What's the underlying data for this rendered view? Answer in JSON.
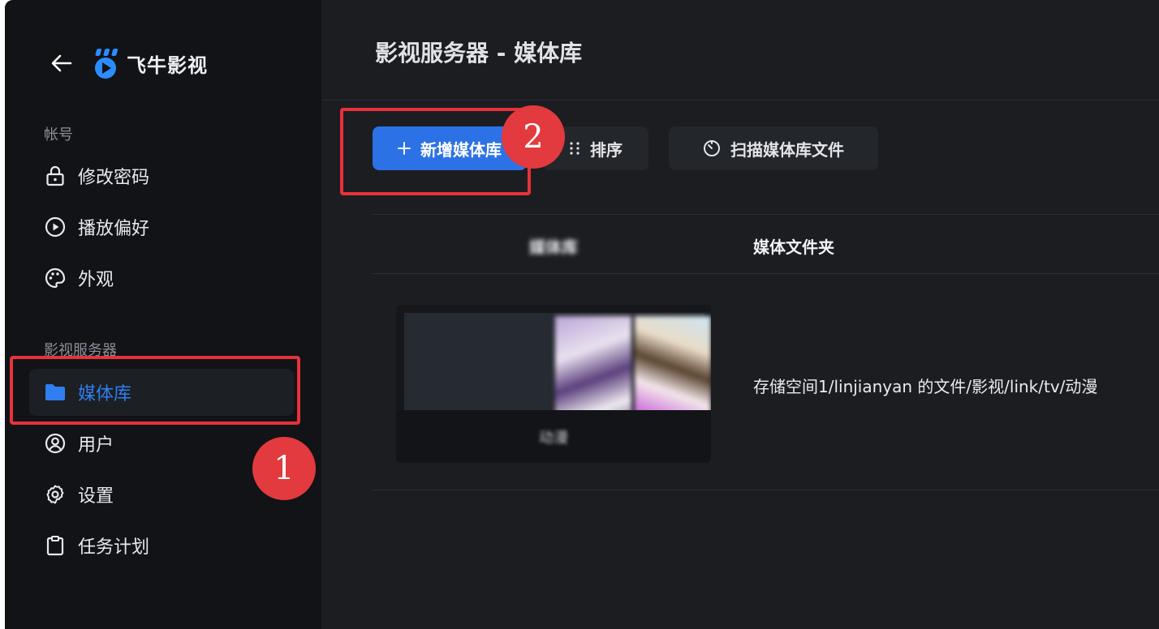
{
  "app": {
    "name": "飞牛影视",
    "brand_color": "#2c72e6"
  },
  "sidebar": {
    "sections": [
      {
        "label": "帐号",
        "items": [
          {
            "label": "修改密码",
            "icon": "lock-icon"
          },
          {
            "label": "播放偏好",
            "icon": "play-circle-icon"
          },
          {
            "label": "外观",
            "icon": "palette-icon"
          }
        ]
      },
      {
        "label": "影视服务器",
        "items": [
          {
            "label": "媒体库",
            "icon": "folder-icon",
            "active": true
          },
          {
            "label": "用户",
            "icon": "user-circle-icon"
          },
          {
            "label": "设置",
            "icon": "gear-icon"
          },
          {
            "label": "任务计划",
            "icon": "clipboard-icon"
          }
        ]
      }
    ]
  },
  "main": {
    "title": "影视服务器 - 媒体库",
    "toolbar": {
      "add_label": "新增媒体库",
      "sort_label": "排序",
      "scan_label": "扫描媒体库文件"
    },
    "table": {
      "headers": [
        "媒体库",
        "媒体文件夹"
      ],
      "rows": [
        {
          "name": "动漫",
          "folder": "存储空间1/linjianyan 的文件/影视/link/tv/动漫"
        }
      ]
    }
  },
  "annotations": [
    {
      "number": "1",
      "color": "#e8313a"
    },
    {
      "number": "2",
      "color": "#e8313a"
    }
  ]
}
